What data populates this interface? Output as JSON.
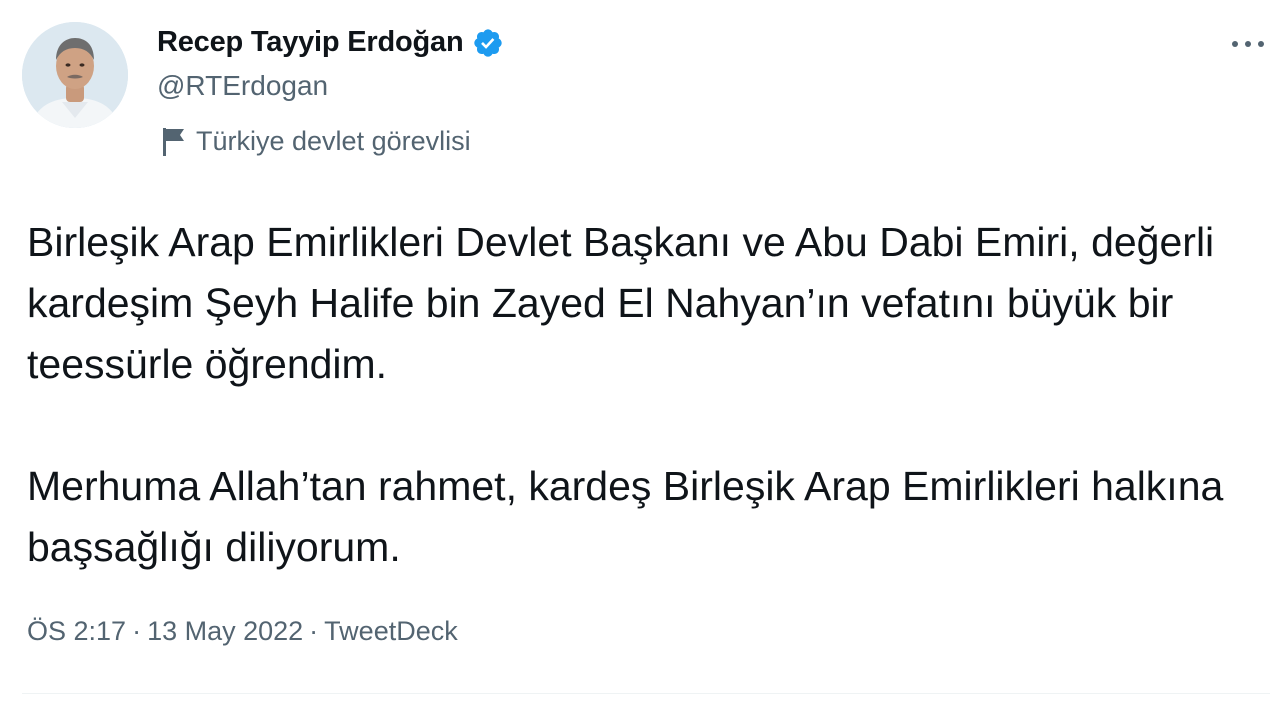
{
  "author": {
    "display_name": "Recep Tayyip Erdoğan",
    "handle": "@RTErdogan",
    "label": "Türkiye devlet görevlisi",
    "verified": true,
    "verified_color": "#1d9bf0",
    "avatar_icon": "profile-photo"
  },
  "tweet": {
    "paragraphs": [
      "Birleşik Arap Emirlikleri Devlet Başkanı ve Abu Dabi Emiri, değerli kardeşim Şeyh Halife bin Zayed El Nahyan’ın vefatını büyük bir teessürle öğrendim.",
      "Merhuma Allah’tan rahmet, kardeş Birleşik Arap Emirlikleri halkına başsağlığı diliyorum."
    ]
  },
  "meta": {
    "time": "ÖS 2:17",
    "separator": "·",
    "date": "13 May 2022",
    "source": "TweetDeck"
  },
  "icons": {
    "more": "more-dots-icon",
    "verified": "verified-badge-icon",
    "label": "flag-icon"
  },
  "colors": {
    "text_primary": "#0f1419",
    "text_secondary": "#536471",
    "divider": "#eff3f4"
  }
}
